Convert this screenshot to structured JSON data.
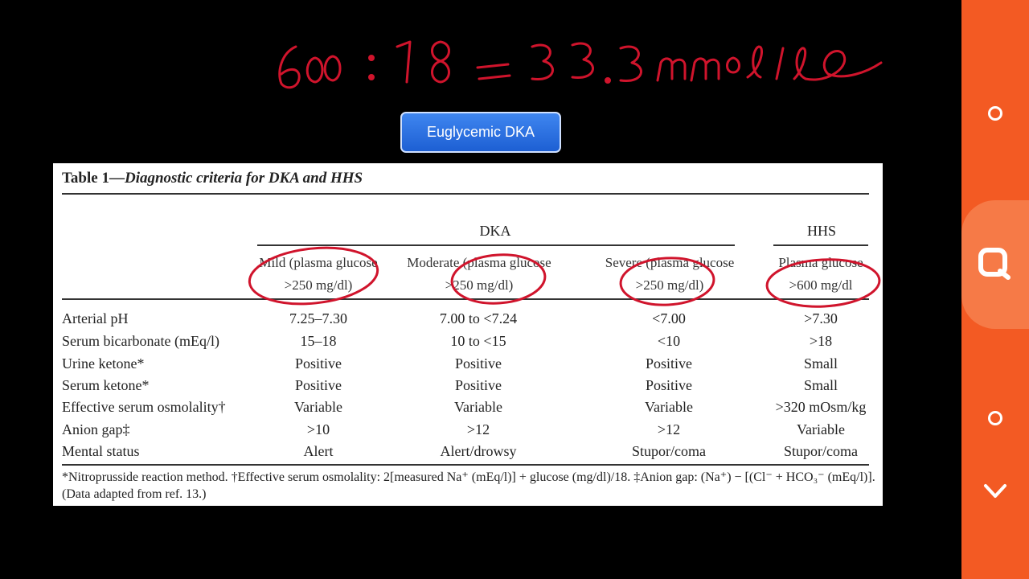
{
  "handwriting": "600 : 18 = 33.3 mmol/l",
  "badge": {
    "label": "Euglycemic DKA"
  },
  "table": {
    "title_prefix": "Table 1—",
    "title_italic": "Diagnostic criteria for DKA and HHS",
    "groups": {
      "dka": "DKA",
      "hhs": "HHS"
    },
    "subheaders": [
      {
        "line1": "Mild (plasma glucose",
        "line2": ">250 mg/dl)"
      },
      {
        "line1": "Moderate (plasma glucose",
        "line2": ">250 mg/dl)"
      },
      {
        "line1": "Severe (plasma glucose",
        "line2": ">250 mg/dl)"
      },
      {
        "line1": "Plasma glucose",
        "line2": ">600 mg/dl"
      }
    ],
    "rows": [
      {
        "label": "Arterial pH",
        "values": [
          "7.25–7.30",
          "7.00 to <7.24",
          "<7.00",
          ">7.30"
        ]
      },
      {
        "label": "Serum bicarbonate (mEq/l)",
        "values": [
          "15–18",
          "10 to <15",
          "<10",
          ">18"
        ]
      },
      {
        "label": "Urine ketone*",
        "values": [
          "Positive",
          "Positive",
          "Positive",
          "Small"
        ]
      },
      {
        "label": "Serum ketone*",
        "values": [
          "Positive",
          "Positive",
          "Positive",
          "Small"
        ]
      },
      {
        "label": "Effective serum osmolality†",
        "values": [
          "Variable",
          "Variable",
          "Variable",
          ">320 mOsm/kg"
        ]
      },
      {
        "label": "Anion gap‡",
        "values": [
          ">10",
          ">12",
          ">12",
          "Variable"
        ]
      },
      {
        "label": "Mental status",
        "values": [
          "Alert",
          "Alert/drowsy",
          "Stupor/coma",
          "Stupor/coma"
        ]
      }
    ],
    "footnote_line1": "*Nitroprusside reaction method. †Effective serum osmolality: 2[measured Na⁺ (mEq/l)] + glucose (mg/dl)/18. ‡Anion gap: (Na⁺) − [(Cl⁻ + HCO₃⁻ (mEq/l)].",
    "footnote_line2": "(Data adapted from ref. 13.)"
  },
  "sidebar": {
    "buttons": [
      {
        "icon": "circle-icon"
      },
      {
        "icon": "search-icon"
      },
      {
        "icon": "circle-icon"
      },
      {
        "icon": "chevron-down-icon"
      }
    ],
    "color": "#f35a23"
  },
  "colors": {
    "ink": "#d0142c",
    "badge": "#2a6fe0",
    "sidebar": "#f35a23"
  }
}
